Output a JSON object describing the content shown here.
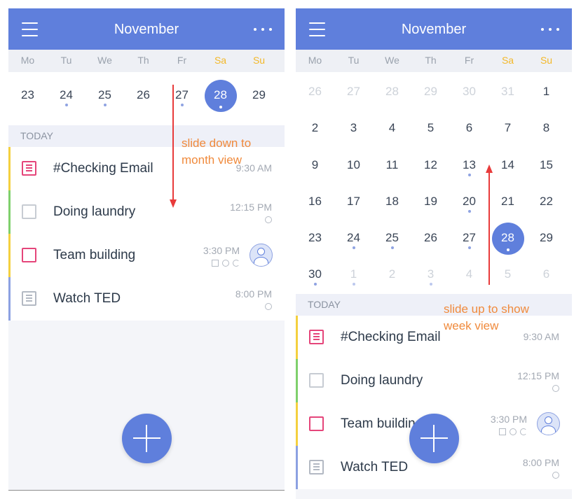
{
  "header": {
    "month": "November"
  },
  "weekdays": [
    "Mo",
    "Tu",
    "We",
    "Th",
    "Fr",
    "Sa",
    "Su"
  ],
  "today_label": "TODAY",
  "week_view": {
    "days": [
      {
        "num": "23",
        "dot": false
      },
      {
        "num": "24",
        "dot": true
      },
      {
        "num": "25",
        "dot": true
      },
      {
        "num": "26",
        "dot": false
      },
      {
        "num": "27",
        "dot": true
      },
      {
        "num": "28",
        "dot": true,
        "selected": true
      },
      {
        "num": "29",
        "dot": false
      }
    ]
  },
  "month_view": {
    "weeks": [
      [
        {
          "num": "26",
          "muted": true
        },
        {
          "num": "27",
          "muted": true
        },
        {
          "num": "28",
          "muted": true
        },
        {
          "num": "29",
          "muted": true
        },
        {
          "num": "30",
          "muted": true
        },
        {
          "num": "31",
          "muted": true
        },
        {
          "num": "1"
        }
      ],
      [
        {
          "num": "2"
        },
        {
          "num": "3"
        },
        {
          "num": "4"
        },
        {
          "num": "5"
        },
        {
          "num": "6"
        },
        {
          "num": "7"
        },
        {
          "num": "8"
        }
      ],
      [
        {
          "num": "9"
        },
        {
          "num": "10"
        },
        {
          "num": "11"
        },
        {
          "num": "12"
        },
        {
          "num": "13",
          "dot": true
        },
        {
          "num": "14"
        },
        {
          "num": "15"
        }
      ],
      [
        {
          "num": "16"
        },
        {
          "num": "17"
        },
        {
          "num": "18"
        },
        {
          "num": "19"
        },
        {
          "num": "20",
          "dot": true
        },
        {
          "num": "21"
        },
        {
          "num": "22"
        }
      ],
      [
        {
          "num": "23"
        },
        {
          "num": "24",
          "dot": true
        },
        {
          "num": "25",
          "dot": true
        },
        {
          "num": "26"
        },
        {
          "num": "27",
          "dot": true
        },
        {
          "num": "28",
          "dot": true,
          "selected": true
        },
        {
          "num": "29"
        }
      ],
      [
        {
          "num": "30",
          "dot": true
        },
        {
          "num": "1",
          "muted": true,
          "dot": true
        },
        {
          "num": "2",
          "muted": true
        },
        {
          "num": "3",
          "muted": true,
          "dot": true
        },
        {
          "num": "4",
          "muted": true
        },
        {
          "num": "5",
          "muted": true
        },
        {
          "num": "6",
          "muted": true
        }
      ]
    ]
  },
  "tasks": [
    {
      "title": "#Checking  Email",
      "time": "9:30 AM",
      "color": "yellow",
      "icon": "note-icon-pink"
    },
    {
      "title": "Doing laundry",
      "time": "12:15 PM",
      "color": "green",
      "icon": "checkbox-gray",
      "badges": [
        "alarm"
      ]
    },
    {
      "title": "Team building",
      "time": "3:30 PM",
      "color": "yellow",
      "icon": "checkbox-pink",
      "badges": [
        "note",
        "alarm",
        "repeat"
      ],
      "avatar": true
    },
    {
      "title": "Watch TED",
      "time": "8:00 PM",
      "color": "blue",
      "icon": "note-icon-gray",
      "badges": [
        "alarm"
      ]
    }
  ],
  "annotations": {
    "down": [
      "slide down to",
      "month view"
    ],
    "up": [
      "slide up to show",
      "week view"
    ]
  },
  "colors": {
    "header": "#5f7fdc",
    "weekend": "#f3b829",
    "annotation": "#f08a3c",
    "arrow": "#e83b3b",
    "accent_pink": "#e5457a"
  }
}
